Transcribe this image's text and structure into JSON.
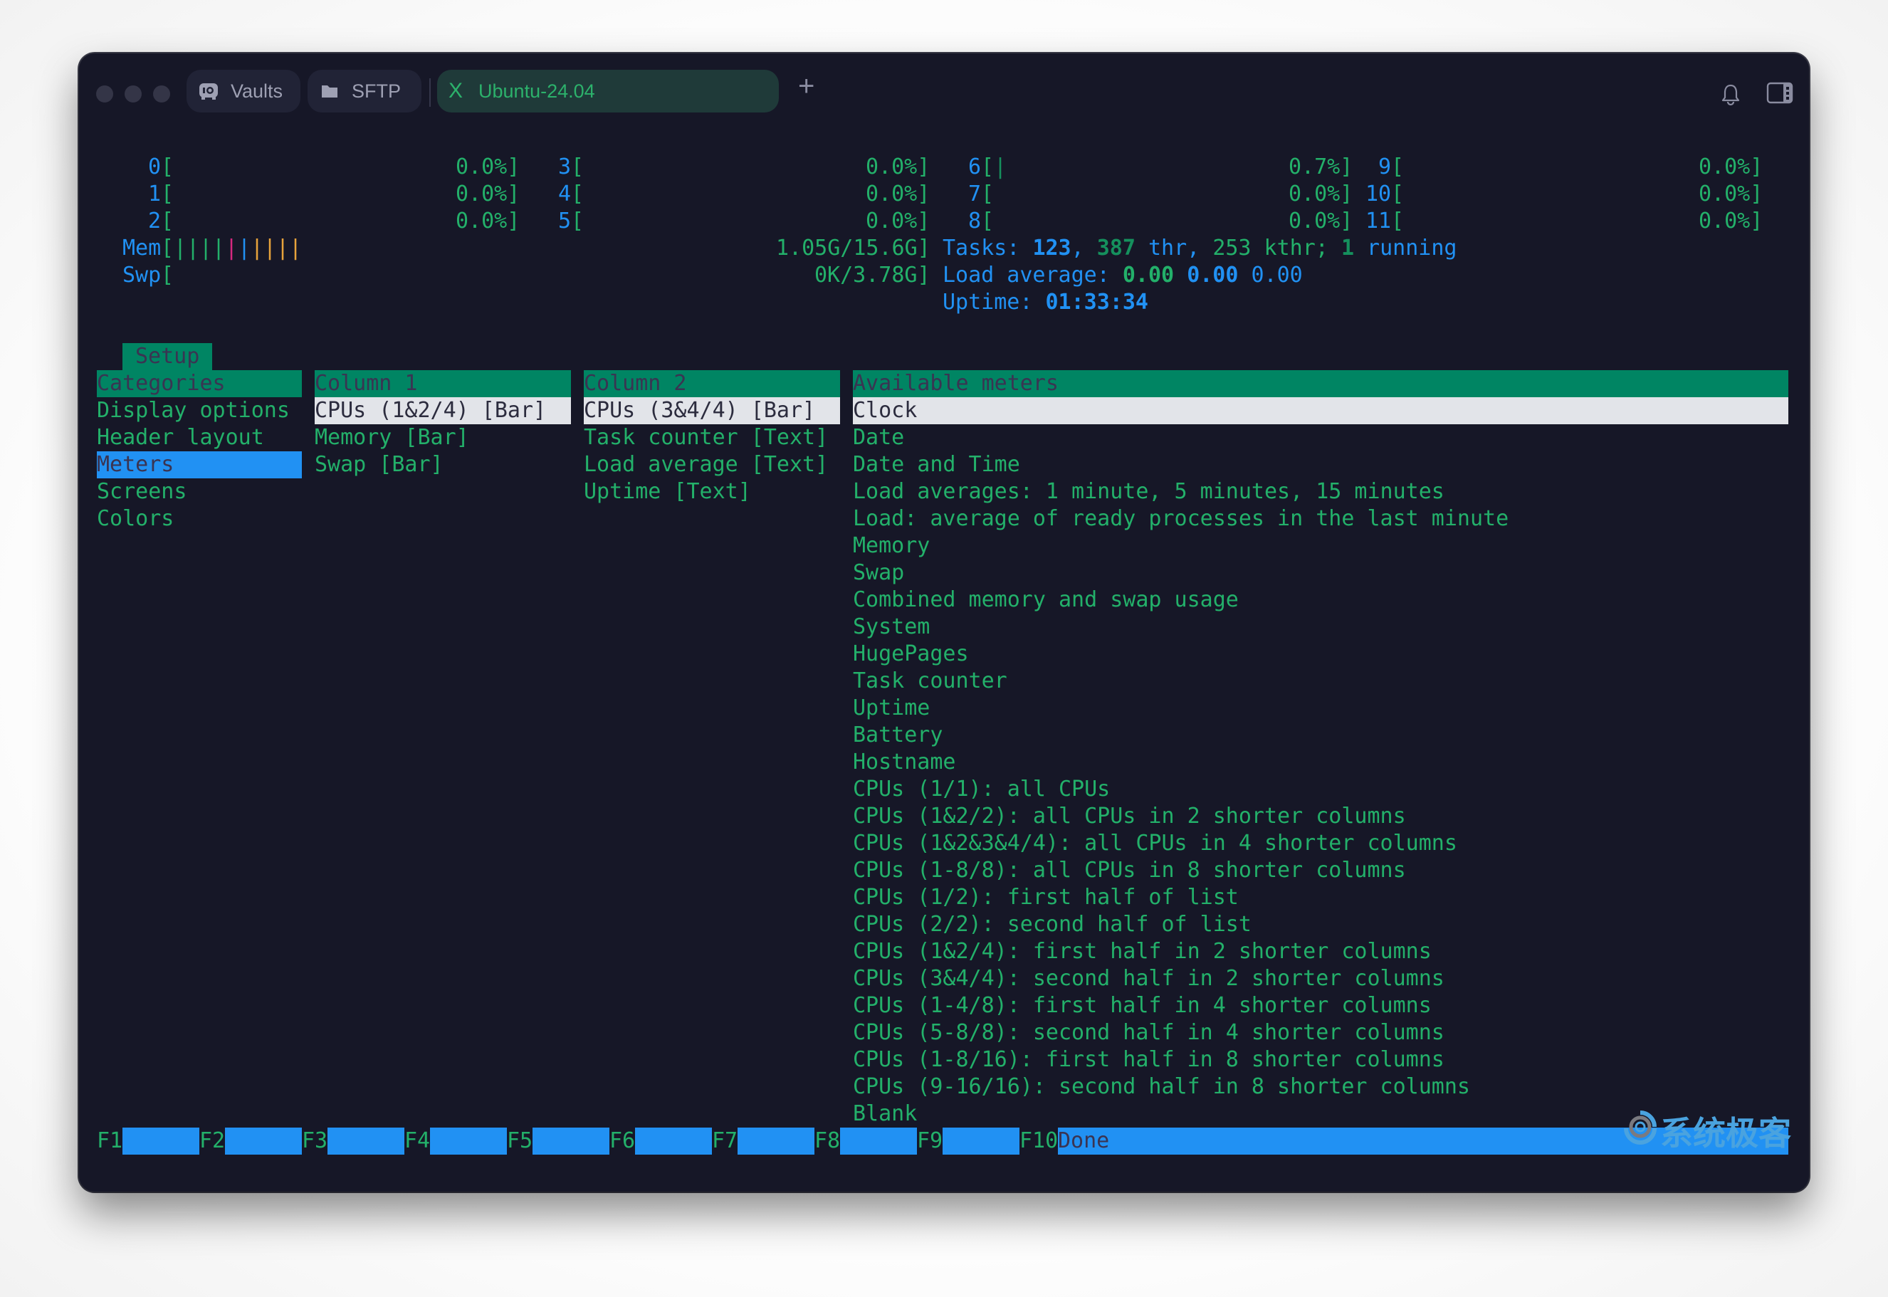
{
  "titlebar": {
    "tabs": [
      {
        "label": "Vaults",
        "icon": "vault-icon"
      },
      {
        "label": "SFTP",
        "icon": "folder-icon"
      },
      {
        "label": "Ubuntu-24.04",
        "icon": "close-icon",
        "close_glyph": "X",
        "active": true
      }
    ],
    "new_tab": "+",
    "notifications_icon": "bell-icon",
    "sidebar_toggle_icon": "panel-icon"
  },
  "header": {
    "cpus": [
      {
        "id": "0",
        "value": "0.0%]",
        "bars": 0
      },
      {
        "id": "1",
        "value": "0.0%]",
        "bars": 0
      },
      {
        "id": "2",
        "value": "0.0%]",
        "bars": 0
      },
      {
        "id": "3",
        "value": "0.0%]",
        "bars": 0
      },
      {
        "id": "4",
        "value": "0.0%]",
        "bars": 0
      },
      {
        "id": "5",
        "value": "0.0%]",
        "bars": 0
      },
      {
        "id": "6",
        "value": "0.7%]",
        "bars": 1
      },
      {
        "id": "7",
        "value": "0.0%]",
        "bars": 0
      },
      {
        "id": "8",
        "value": "0.0%]",
        "bars": 0
      },
      {
        "id": "9",
        "value": "0.0%]",
        "bars": 0
      },
      {
        "id": "10",
        "value": "0.0%]",
        "bars": 0
      },
      {
        "id": "11",
        "value": "0.0%]",
        "bars": 0
      }
    ],
    "open_bracket": "[",
    "mem": {
      "label": "Mem",
      "value": "1.05G/15.6G]",
      "bar_glyph": "|",
      "bar_colors": [
        "#23b06a",
        "#23b06a",
        "#23b06a",
        "#23b06a",
        "#d6287f",
        "#2191f3",
        "#e7a33c",
        "#e7a33c",
        "#e7a33c",
        "#e7a33c"
      ]
    },
    "swp": {
      "label": "Swp",
      "value": "0K/3.78G]"
    },
    "tasks": {
      "label": "Tasks: ",
      "total": "123",
      "sep1": ", ",
      "threads": "387",
      "thr": " thr, ",
      "kthr": "253 kthr; ",
      "running": "1",
      "running_label": " running"
    },
    "load": {
      "label": "Load average: ",
      "one": "0.00",
      "five": "0.00",
      "fifteen": "0.00"
    },
    "uptime": {
      "label": "Uptime: ",
      "value": "01:33:34"
    }
  },
  "setup": {
    "tab_label": "Setup",
    "categories": {
      "header": "Categories",
      "items": [
        "Display options",
        "Header layout",
        "Meters",
        "Screens",
        "Colors"
      ],
      "selected": "Meters"
    },
    "column1": {
      "header": "Column 1",
      "items": [
        "CPUs (1&2/4) [Bar]",
        "Memory [Bar]",
        "Swap [Bar]"
      ]
    },
    "column2": {
      "header": "Column 2",
      "items": [
        "CPUs (3&4/4) [Bar]",
        "Task counter [Text]",
        "Load average [Text]",
        "Uptime [Text]"
      ]
    },
    "available": {
      "header": "Available meters",
      "items": [
        "Clock",
        "Date",
        "Date and Time",
        "Load averages: 1 minute, 5 minutes, 15 minutes",
        "Load: average of ready processes in the last minute",
        "Memory",
        "Swap",
        "Combined memory and swap usage",
        "System",
        "HugePages",
        "Task counter",
        "Uptime",
        "Battery",
        "Hostname",
        "CPUs (1/1): all CPUs",
        "CPUs (1&2/2): all CPUs in 2 shorter columns",
        "CPUs (1&2&3&4/4): all CPUs in 4 shorter columns",
        "CPUs (1-8/8): all CPUs in 8 shorter columns",
        "CPUs (1/2): first half of list",
        "CPUs (2/2): second half of list",
        "CPUs (1&2/4): first half in 2 shorter columns",
        "CPUs (3&4/4): second half in 2 shorter columns",
        "CPUs (1-4/8): first half in 4 shorter columns",
        "CPUs (5-8/8): second half in 4 shorter columns",
        "CPUs (1-8/16): first half in 8 shorter columns",
        "CPUs (9-16/16): second half in 8 shorter columns",
        "Blank"
      ]
    }
  },
  "function_keys": [
    {
      "key": "F1",
      "label": ""
    },
    {
      "key": "F2",
      "label": ""
    },
    {
      "key": "F3",
      "label": ""
    },
    {
      "key": "F4",
      "label": ""
    },
    {
      "key": "F5",
      "label": ""
    },
    {
      "key": "F6",
      "label": ""
    },
    {
      "key": "F7",
      "label": ""
    },
    {
      "key": "F8",
      "label": ""
    },
    {
      "key": "F9",
      "label": ""
    },
    {
      "key": "F10",
      "label": "Done"
    }
  ],
  "watermark": {
    "text": "系统极客",
    "icon": "logo-icon"
  }
}
